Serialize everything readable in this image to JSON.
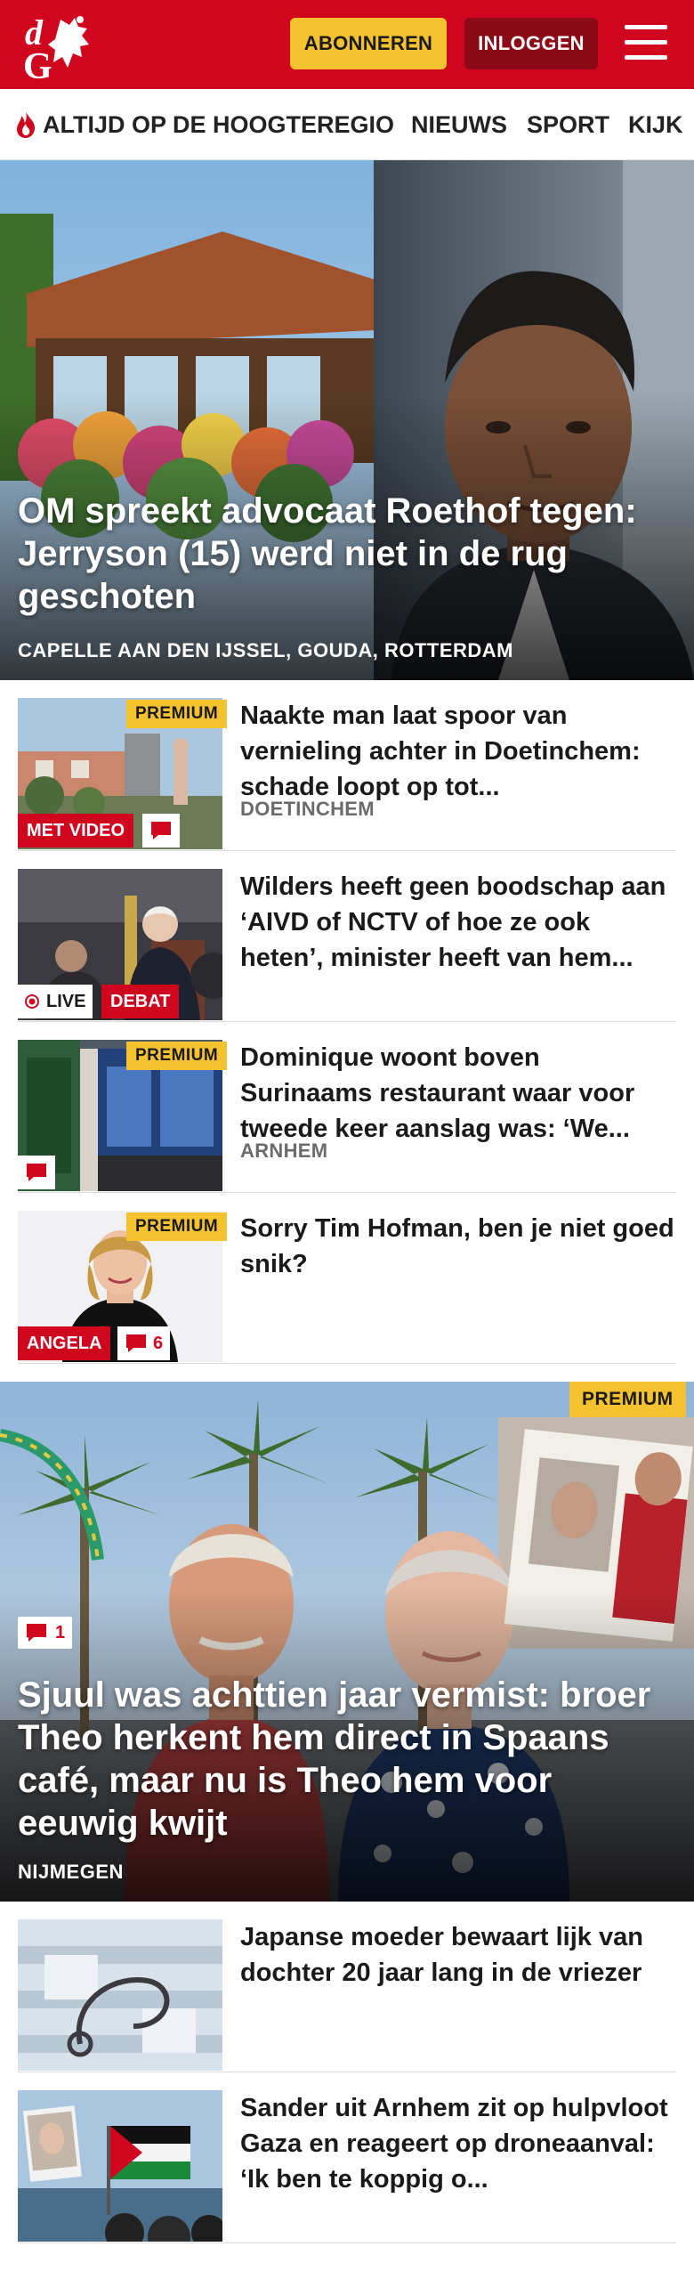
{
  "header": {
    "logo_text": "dG",
    "subscribe_label": "ABONNEREN",
    "login_label": "INLOGGEN",
    "brand_color": "#d0061f",
    "subscribe_color": "#f5c22f",
    "login_color": "#8c0916"
  },
  "nav": {
    "items": [
      {
        "label": "ALTIJD OP DE HOOGTE",
        "icon": "flame-icon"
      },
      {
        "label": "REGIO"
      },
      {
        "label": "NIEUWS"
      },
      {
        "label": "SPORT"
      },
      {
        "label": "KIJK"
      }
    ]
  },
  "hero": {
    "title": "OM spreekt advocaat Roethof tegen: Jerryson (15) werd niet in de rug geschoten",
    "location": "CAPELLE AAN DEN IJSSEL, GOUDA, ROTTERDAM"
  },
  "articles": [
    {
      "title": "Naakte man laat spoor van vernieling achter in Doetinchem: schade loopt op tot...",
      "location": "DOETINCHEM",
      "premium": "PREMIUM",
      "badge": "MET VIDEO",
      "comment_icon": "comment-icon"
    },
    {
      "title": "Wilders heeft geen boodschap aan ‘AIVD of NCTV of hoe ze ook heten’, minister heeft van hem...",
      "live_label": "LIVE",
      "badge": "DEBAT"
    },
    {
      "title": "Dominique woont boven Surinaams restaurant waar voor tweede keer aanslag was: ‘We...",
      "location": "ARNHEM",
      "premium": "PREMIUM",
      "comment_icon": "comment-icon"
    },
    {
      "title": "Sorry Tim Hofman, ben je niet goed snik?",
      "premium": "PREMIUM",
      "badge": "ANGELA",
      "comment_count": "6"
    }
  ],
  "feature": {
    "title": "Sjuul was achttien jaar vermist: broer Theo herkent hem direct in Spaans café, maar nu is Theo hem voor eeuwig kwijt",
    "location": "NIJMEGEN",
    "premium": "PREMIUM",
    "comment_count": "1"
  },
  "more_articles": [
    {
      "title": "Japanse moeder bewaart lijk van dochter 20 jaar lang in de vriezer"
    },
    {
      "title": "Sander uit Arnhem zit op hulpvloot Gaza en reageert op droneaanval: ‘Ik ben te koppig o..."
    }
  ]
}
